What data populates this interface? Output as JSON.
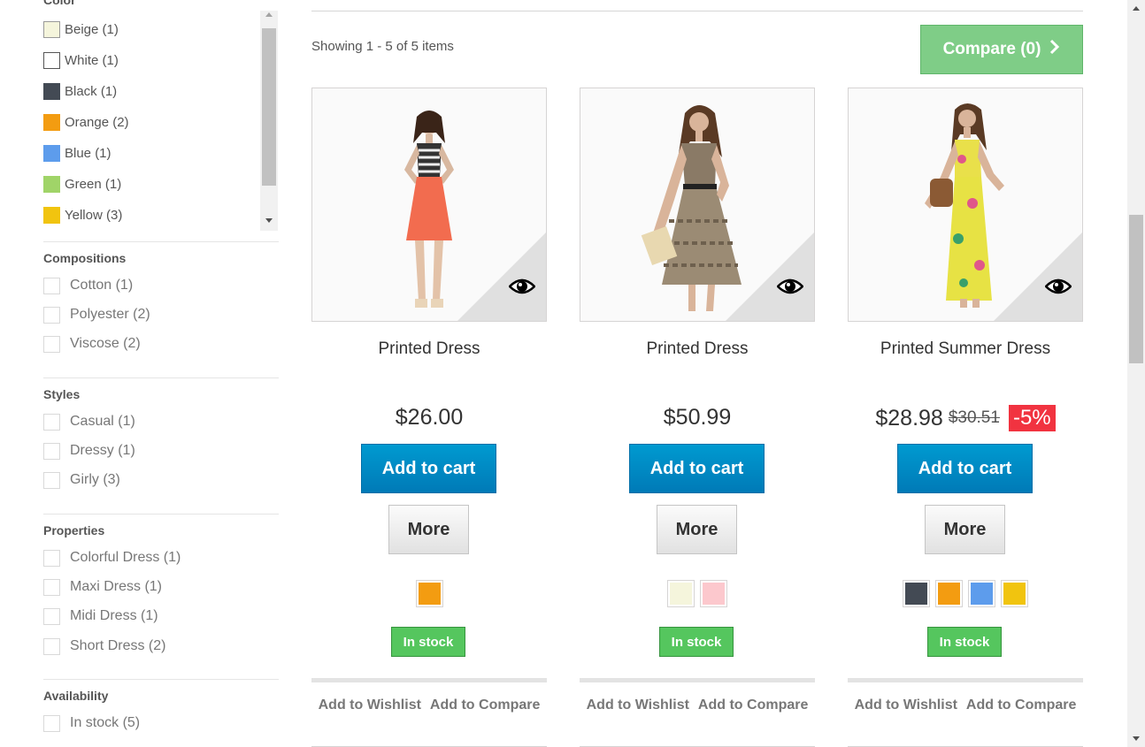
{
  "sidebar": {
    "color": {
      "title": "Color",
      "items": [
        {
          "label": "Beige (1)",
          "color": "#f5f5dc"
        },
        {
          "label": "White (1)",
          "color": "#ffffff"
        },
        {
          "label": "Black (1)",
          "color": "#434a54"
        },
        {
          "label": "Orange (2)",
          "color": "#f39c11"
        },
        {
          "label": "Blue (1)",
          "color": "#5d9cec"
        },
        {
          "label": "Green (1)",
          "color": "#a0d468"
        },
        {
          "label": "Yellow (3)",
          "color": "#f1c40f"
        }
      ]
    },
    "compositions": {
      "title": "Compositions",
      "items": [
        "Cotton (1)",
        "Polyester (2)",
        "Viscose (2)"
      ]
    },
    "styles": {
      "title": "Styles",
      "items": [
        "Casual (1)",
        "Dressy (1)",
        "Girly (3)"
      ]
    },
    "properties": {
      "title": "Properties",
      "items": [
        "Colorful Dress (1)",
        "Maxi Dress (1)",
        "Midi Dress (1)",
        "Short Dress (2)"
      ]
    },
    "availability": {
      "title": "Availability",
      "items": [
        "In stock (5)"
      ]
    }
  },
  "main": {
    "showing": "Showing 1 - 5 of 5 items",
    "compare_label": "Compare (0)",
    "products": [
      {
        "name": "Printed Dress",
        "price": "$26.00",
        "old_price": "",
        "discount": "",
        "cart_label": "Add to cart",
        "more_label": "More",
        "colors": [
          "#f39c11"
        ],
        "stock": "In stock",
        "wishlist": "Add to Wishlist",
        "compare": "Add to Compare"
      },
      {
        "name": "Printed Dress",
        "price": "$50.99",
        "old_price": "",
        "discount": "",
        "cart_label": "Add to cart",
        "more_label": "More",
        "colors": [
          "#f5f5dc",
          "#fcc8cd"
        ],
        "stock": "In stock",
        "wishlist": "Add to Wishlist",
        "compare": "Add to Compare"
      },
      {
        "name": "Printed Summer Dress",
        "price": "$28.98",
        "old_price": "$30.51",
        "discount": "-5%",
        "cart_label": "Add to cart",
        "more_label": "More",
        "colors": [
          "#434a54",
          "#f39c11",
          "#5d9cec",
          "#f1c40f"
        ],
        "stock": "In stock",
        "wishlist": "Add to Wishlist",
        "compare": "Add to Compare"
      }
    ]
  },
  "icons": {
    "quick_view": "eye-icon",
    "compare_arrow": "chevron-right-icon"
  },
  "colors": {
    "compare_button": "#7fcd87",
    "cart_button": "#0088c6",
    "in_stock": "#55c65e",
    "discount": "#f13340"
  }
}
